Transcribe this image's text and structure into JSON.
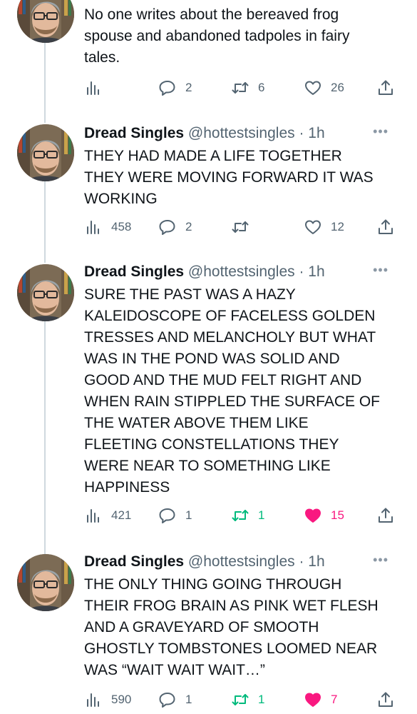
{
  "accent_colors": {
    "retweet": "#00ba7c",
    "like": "#f91880",
    "muted": "#536471"
  },
  "tweets": [
    {
      "name": "",
      "handle": "",
      "time": "",
      "lines": [
        "No one writes about the bereaved frog",
        "spouse and abandoned tadpoles in fairy",
        "tales."
      ],
      "views": "",
      "replies": "2",
      "retweets": "6",
      "likes": "26",
      "retweeted": false,
      "liked": false
    },
    {
      "name": "Dread Singles",
      "handle": "@hottestsingles",
      "time": "· 1h",
      "lines": [
        "THEY HAD MADE A LIFE TOGETHER",
        "THEY WERE MOVING FORWARD IT WAS",
        "WORKING"
      ],
      "views": "458",
      "replies": "2",
      "retweets": "",
      "likes": "12",
      "retweeted": false,
      "liked": false
    },
    {
      "name": "Dread Singles",
      "handle": "@hottestsingles",
      "time": "· 1h",
      "lines": [
        "SURE THE PAST WAS A HAZY",
        "KALEIDOSCOPE OF FACELESS GOLDEN",
        "TRESSES AND MELANCHOLY BUT WHAT",
        "WAS IN THE POND WAS SOLID AND",
        "GOOD AND THE MUD FELT RIGHT AND",
        "WHEN RAIN STIPPLED THE SURFACE OF",
        "THE WATER ABOVE THEM  LIKE",
        "FLEETING CONSTELLATIONS THEY",
        "WERE NEAR TO SOMETHING LIKE",
        "HAPPINESS"
      ],
      "views": "421",
      "replies": "1",
      "retweets": "1",
      "likes": "15",
      "retweeted": true,
      "liked": true
    },
    {
      "name": "Dread Singles",
      "handle": "@hottestsingles",
      "time": "· 1h",
      "lines": [
        "THE ONLY THING GOING THROUGH",
        "THEIR FROG BRAIN AS PINK WET FLESH",
        "AND A GRAVEYARD OF SMOOTH",
        "GHOSTLY TOMBSTONES LOOMED NEAR",
        "WAS “WAIT WAIT WAIT…”"
      ],
      "views": "590",
      "replies": "1",
      "retweets": "1",
      "likes": "7",
      "retweeted": true,
      "liked": true
    }
  ]
}
